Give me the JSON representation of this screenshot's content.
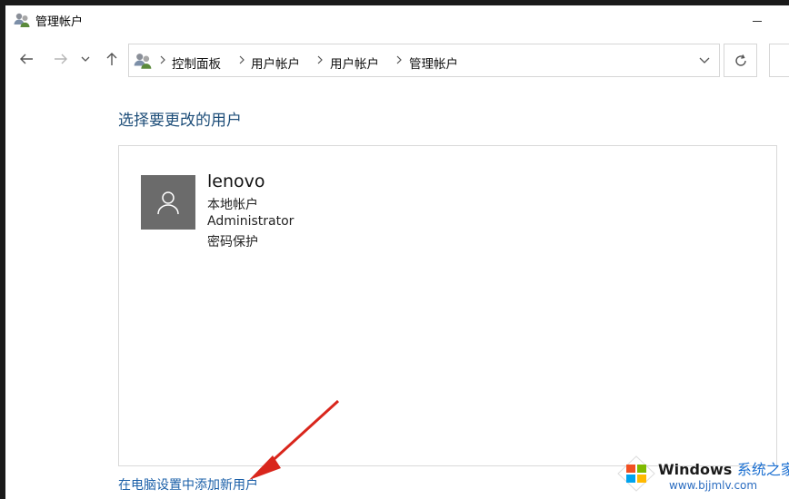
{
  "window": {
    "title": "管理帐户"
  },
  "navigation": {
    "breadcrumbs": [
      "控制面板",
      "用户帐户",
      "用户帐户",
      "管理帐户"
    ]
  },
  "content": {
    "heading": "选择要更改的用户",
    "user": {
      "name": "lenovo",
      "account_type": "本地帐户",
      "role": "Administrator",
      "protection": "密码保护"
    },
    "add_user_link": "在电脑设置中添加新用户"
  },
  "watermark": {
    "brand_en": "Windows",
    "brand_cn": "系统之家",
    "url": "www.bjjmlv.com"
  },
  "colors": {
    "heading": "#1e4e79",
    "link": "#1a5fa8",
    "annotation_arrow": "#d9261c"
  }
}
